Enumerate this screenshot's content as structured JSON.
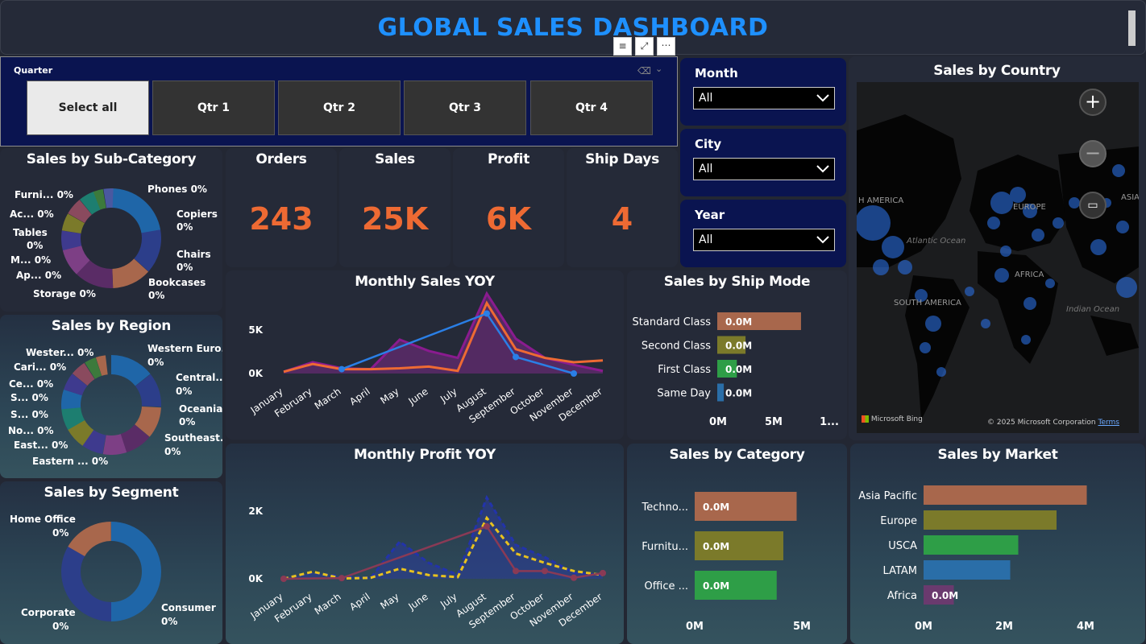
{
  "header": {
    "title": "GLOBAL SALES DASHBOARD"
  },
  "quarter_slicer": {
    "label": "Quarter",
    "options": [
      "Select all",
      "Qtr 1",
      "Qtr 2",
      "Qtr 3",
      "Qtr 4"
    ],
    "selected": "Select all"
  },
  "filters": {
    "month": {
      "label": "Month",
      "value": "All"
    },
    "city": {
      "label": "City",
      "value": "All"
    },
    "year": {
      "label": "Year",
      "value": "All"
    }
  },
  "kpis": {
    "orders": {
      "label": "Orders",
      "value": "243"
    },
    "sales": {
      "label": "Sales",
      "value": "25K"
    },
    "profit": {
      "label": "Profit",
      "value": "6K"
    },
    "ship_days": {
      "label": "Ship Days",
      "value": "4"
    }
  },
  "colors": {
    "accent": "#ee6a33",
    "title_blue": "#1e90ff",
    "navy": "#0a1450"
  },
  "subcategory": {
    "title": "Sales by Sub-Category",
    "labels": [
      "Phones 0%",
      "Copiers",
      "0%",
      "Chairs",
      "0%",
      "Bookcases",
      "0%",
      "Furni... 0%",
      "Ac... 0%",
      "Tables",
      "0%",
      "M... 0%",
      "Ap... 0%",
      "Storage 0%"
    ]
  },
  "region": {
    "title": "Sales by Region",
    "labels": [
      "Wester... 0%",
      "Cari... 0%",
      "Ce... 0%",
      "S... 0%",
      "S... 0%",
      "No... 0%",
      "East... 0%",
      "Eastern ... 0%",
      "Western Euro...",
      "0%",
      "Central...",
      "0%",
      "Oceania",
      "0%",
      "Southeast...",
      "0%"
    ]
  },
  "segment": {
    "title": "Sales by Segment",
    "labels": [
      "Home Office",
      "0%",
      "Corporate",
      "0%",
      "Consumer",
      "0%"
    ]
  },
  "map": {
    "title": "Sales by Country",
    "labels": [
      "H AMERICA",
      "EUROPE",
      "ASIA",
      "Atlantic Ocean",
      "AFRICA",
      "SOUTH AMERICA",
      "Indian Ocean"
    ],
    "attribution": "Microsoft Bing",
    "copyright": "© 2025 Microsoft Corporation",
    "terms": "Terms"
  },
  "chart_data": [
    {
      "type": "line",
      "title": "Monthly Sales YOY",
      "categories": [
        "January",
        "February",
        "March",
        "April",
        "May",
        "June",
        "July",
        "August",
        "September",
        "October",
        "November",
        "December"
      ],
      "y_ticks": [
        "5K",
        "0K"
      ],
      "series": [
        {
          "values": [
            200,
            1300,
            600,
            500,
            3900,
            2600,
            1800,
            9200,
            4000,
            1800,
            1000,
            300
          ]
        },
        {
          "values": [
            200,
            1100,
            500,
            500,
            600,
            800,
            300,
            8100,
            2800,
            1800,
            1300,
            1500
          ]
        },
        {
          "values": [
            null,
            null,
            500,
            null,
            null,
            null,
            null,
            6900,
            1900,
            null,
            0,
            null
          ]
        }
      ]
    },
    {
      "type": "bar",
      "title": "Sales by Ship Mode",
      "categories": [
        "Standard Class",
        "Second Class",
        "First Class",
        "Same Day"
      ],
      "values": [
        7.7,
        2.6,
        1.8,
        0.6
      ],
      "data_labels": [
        "0.0M",
        "0.0M",
        "0.0M",
        "0.0M"
      ],
      "x_ticks": [
        "0M",
        "5M",
        "1..."
      ]
    },
    {
      "type": "line",
      "title": "Monthly Profit YOY",
      "categories": [
        "January",
        "February",
        "March",
        "April",
        "May",
        "June",
        "July",
        "August",
        "September",
        "October",
        "November",
        "December"
      ],
      "y_ticks": [
        "2K",
        "0K"
      ],
      "series": [
        {
          "values": [
            10,
            180,
            60,
            30,
            1100,
            470,
            120,
            2400,
            1000,
            640,
            180,
            110
          ]
        },
        {
          "values": [
            0,
            210,
            10,
            30,
            300,
            110,
            50,
            1800,
            750,
            470,
            230,
            110
          ]
        },
        {
          "values": [
            0,
            null,
            20,
            null,
            null,
            null,
            null,
            1550,
            230,
            230,
            30,
            170
          ]
        }
      ]
    },
    {
      "type": "bar",
      "title": "Sales by Category",
      "categories": [
        "Techno...",
        "Furnitu...",
        "Office ..."
      ],
      "values": [
        4.6,
        4.0,
        3.7
      ],
      "data_labels": [
        "0.0M",
        "0.0M",
        "0.0M"
      ],
      "x_ticks": [
        "0M",
        "5M"
      ]
    },
    {
      "type": "bar",
      "title": "Sales by Market",
      "categories": [
        "Asia Pacific",
        "Europe",
        "USCA",
        "LATAM",
        "Africa"
      ],
      "values": [
        4.05,
        3.3,
        2.35,
        2.15,
        0.75
      ],
      "data_labels": [
        "",
        "",
        "",
        "",
        "0.0M"
      ],
      "x_ticks": [
        "0M",
        "2M",
        "4M"
      ]
    }
  ]
}
